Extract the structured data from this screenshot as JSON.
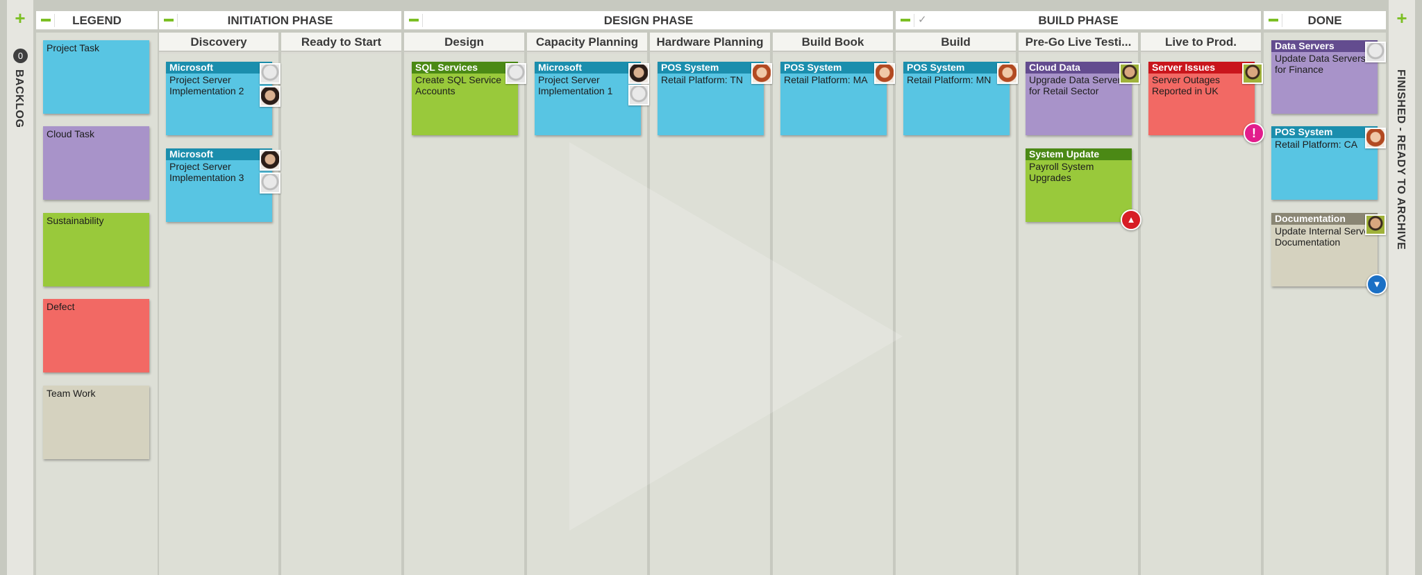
{
  "rails": {
    "backlog": {
      "label": "BACKLOG",
      "count": "0"
    },
    "archive": {
      "label": "FINISHED - READY TO ARCHIVE"
    }
  },
  "phases": {
    "legend": "LEGEND",
    "initiation": "INITIATION PHASE",
    "design": "DESIGN PHASE",
    "build": "BUILD PHASE",
    "done": "DONE"
  },
  "columns": {
    "discovery": "Discovery",
    "ready": "Ready to Start",
    "design": "Design",
    "capacity": "Capacity Planning",
    "hardware": "Hardware Planning",
    "buildbook": "Build Book",
    "build": "Build",
    "prego": "Pre-Go Live Testi...",
    "live": "Live to Prod."
  },
  "legend": [
    {
      "label": "Project Task",
      "color": "#58c5e3"
    },
    {
      "label": "Cloud Task",
      "color": "#a893c9"
    },
    {
      "label": "Sustainability",
      "color": "#99c93b"
    },
    {
      "label": "Defect",
      "color": "#f26964"
    },
    {
      "label": "Team Work",
      "color": "#d5d2bf"
    }
  ],
  "cards": {
    "disc1": {
      "title": "Microsoft",
      "text": "Project Server Implementation 2"
    },
    "disc2": {
      "title": "Microsoft",
      "text": "Project Server Implementation 3"
    },
    "sql": {
      "title": "SQL Services",
      "text": "Create SQL Service Accounts"
    },
    "cap": {
      "title": "Microsoft",
      "text": "Project Server Implementation 1"
    },
    "hw": {
      "title": "POS System",
      "text": "Retail Platform: TN"
    },
    "bb": {
      "title": "POS System",
      "text": "Retail Platform: MA"
    },
    "build": {
      "title": "POS System",
      "text": "Retail Platform: MN"
    },
    "cloud": {
      "title": "Cloud Data",
      "text": "Upgrade Data Servers for Retail Sector"
    },
    "sysupd": {
      "title": "System Update",
      "text": "Payroll System Upgrades"
    },
    "server": {
      "title": "Server Issues",
      "text": "Server Outages Reported in UK"
    },
    "ds": {
      "title": "Data Servers",
      "text": "Update Data Servers for Finance"
    },
    "pos": {
      "title": "POS System",
      "text": "Retail Platform: CA"
    },
    "doc": {
      "title": "Documentation",
      "text": "Update Internal Server Documentation"
    }
  },
  "icons": {
    "add": "+",
    "collapse": "minus",
    "build_check": "✓",
    "blocked": "!",
    "priority_high": "▲",
    "priority_low": "▼"
  }
}
